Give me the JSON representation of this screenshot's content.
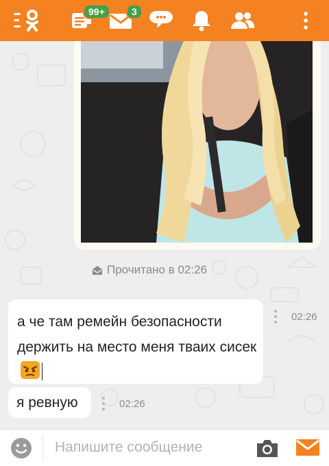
{
  "colors": {
    "accent": "#f58220",
    "badge": "#43a047",
    "background": "#eeeeee"
  },
  "header": {
    "icons": [
      "ok-logo-menu-icon",
      "notes-icon",
      "messages-icon",
      "discussions-icon",
      "notifications-icon",
      "friends-icon",
      "more-icon"
    ],
    "notes_badge": "99+",
    "messages_badge": "3"
  },
  "chat": {
    "photo_alt_icon": "photo-image",
    "read_status": "Прочитано в 02:26",
    "messages": [
      {
        "text": "а че там ремейн безопасности держить на место меня тваих сисек",
        "emoji": "jealous-smiley",
        "time": "02:26"
      },
      {
        "text": "я ревную",
        "time": "02:26"
      }
    ]
  },
  "composer": {
    "placeholder": "Напишите сообщение",
    "icons": [
      "smiley-icon",
      "camera-icon",
      "send-icon"
    ]
  }
}
